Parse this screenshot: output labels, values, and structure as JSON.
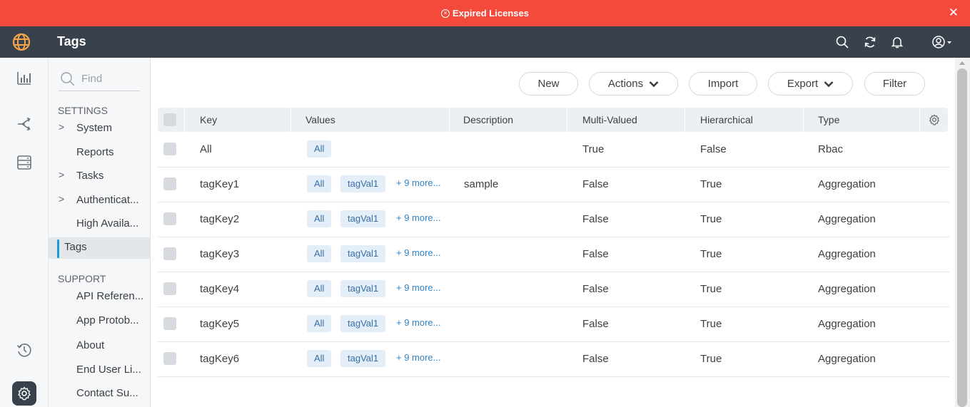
{
  "banner": {
    "text": "Expired Licenses",
    "close": "✕"
  },
  "header": {
    "title": "Tags"
  },
  "search": {
    "placeholder": "Find"
  },
  "nav": {
    "settings_heading": "SETTINGS",
    "settings_items": [
      {
        "label": "System",
        "expandable": true
      },
      {
        "label": "Reports",
        "expandable": false
      },
      {
        "label": "Tasks",
        "expandable": true
      },
      {
        "label": "Authenticat...",
        "expandable": true
      },
      {
        "label": "High Availa...",
        "expandable": false
      },
      {
        "label": "Tags",
        "expandable": false,
        "active": true
      }
    ],
    "support_heading": "SUPPORT",
    "support_items": [
      {
        "label": "API Referen..."
      },
      {
        "label": "App Protob..."
      },
      {
        "label": "About"
      },
      {
        "label": "End User Li..."
      },
      {
        "label": "Contact Su..."
      }
    ]
  },
  "toolbar": {
    "new_label": "New",
    "actions_label": "Actions",
    "import_label": "Import",
    "export_label": "Export",
    "filter_label": "Filter"
  },
  "table": {
    "columns": [
      "Key",
      "Values",
      "Description",
      "Multi-Valued",
      "Hierarchical",
      "Type"
    ],
    "rows": [
      {
        "key": "All",
        "values": [
          "All"
        ],
        "more": "",
        "description": "",
        "multi_valued": "True",
        "hierarchical": "False",
        "type": "Rbac"
      },
      {
        "key": "tagKey1",
        "values": [
          "All",
          "tagVal1"
        ],
        "more": "+ 9 more...",
        "description": "sample",
        "multi_valued": "False",
        "hierarchical": "True",
        "type": "Aggregation"
      },
      {
        "key": "tagKey2",
        "values": [
          "All",
          "tagVal1"
        ],
        "more": "+ 9 more...",
        "description": "",
        "multi_valued": "False",
        "hierarchical": "True",
        "type": "Aggregation"
      },
      {
        "key": "tagKey3",
        "values": [
          "All",
          "tagVal1"
        ],
        "more": "+ 9 more...",
        "description": "",
        "multi_valued": "False",
        "hierarchical": "True",
        "type": "Aggregation"
      },
      {
        "key": "tagKey4",
        "values": [
          "All",
          "tagVal1"
        ],
        "more": "+ 9 more...",
        "description": "",
        "multi_valued": "False",
        "hierarchical": "True",
        "type": "Aggregation"
      },
      {
        "key": "tagKey5",
        "values": [
          "All",
          "tagVal1"
        ],
        "more": "+ 9 more...",
        "description": "",
        "multi_valued": "False",
        "hierarchical": "True",
        "type": "Aggregation"
      },
      {
        "key": "tagKey6",
        "values": [
          "All",
          "tagVal1"
        ],
        "more": "+ 9 more...",
        "description": "",
        "multi_valued": "False",
        "hierarchical": "True",
        "type": "Aggregation"
      }
    ]
  },
  "icons": {
    "banner": "error-circle-icon",
    "logo": "globe-logo-icon",
    "header": [
      "search-icon",
      "refresh-icon",
      "bell-icon",
      "user-account-icon"
    ],
    "rail": [
      "bar-chart-icon",
      "traffic-flow-icon",
      "server-icon",
      "history-icon",
      "gear-icon"
    ]
  },
  "colors": {
    "banner": "#f44a3c",
    "header": "#38414c",
    "logo": "#f5a64b",
    "accent": "#1a9ad6",
    "chip_bg": "#e3eef9",
    "link": "#2f83c6"
  }
}
